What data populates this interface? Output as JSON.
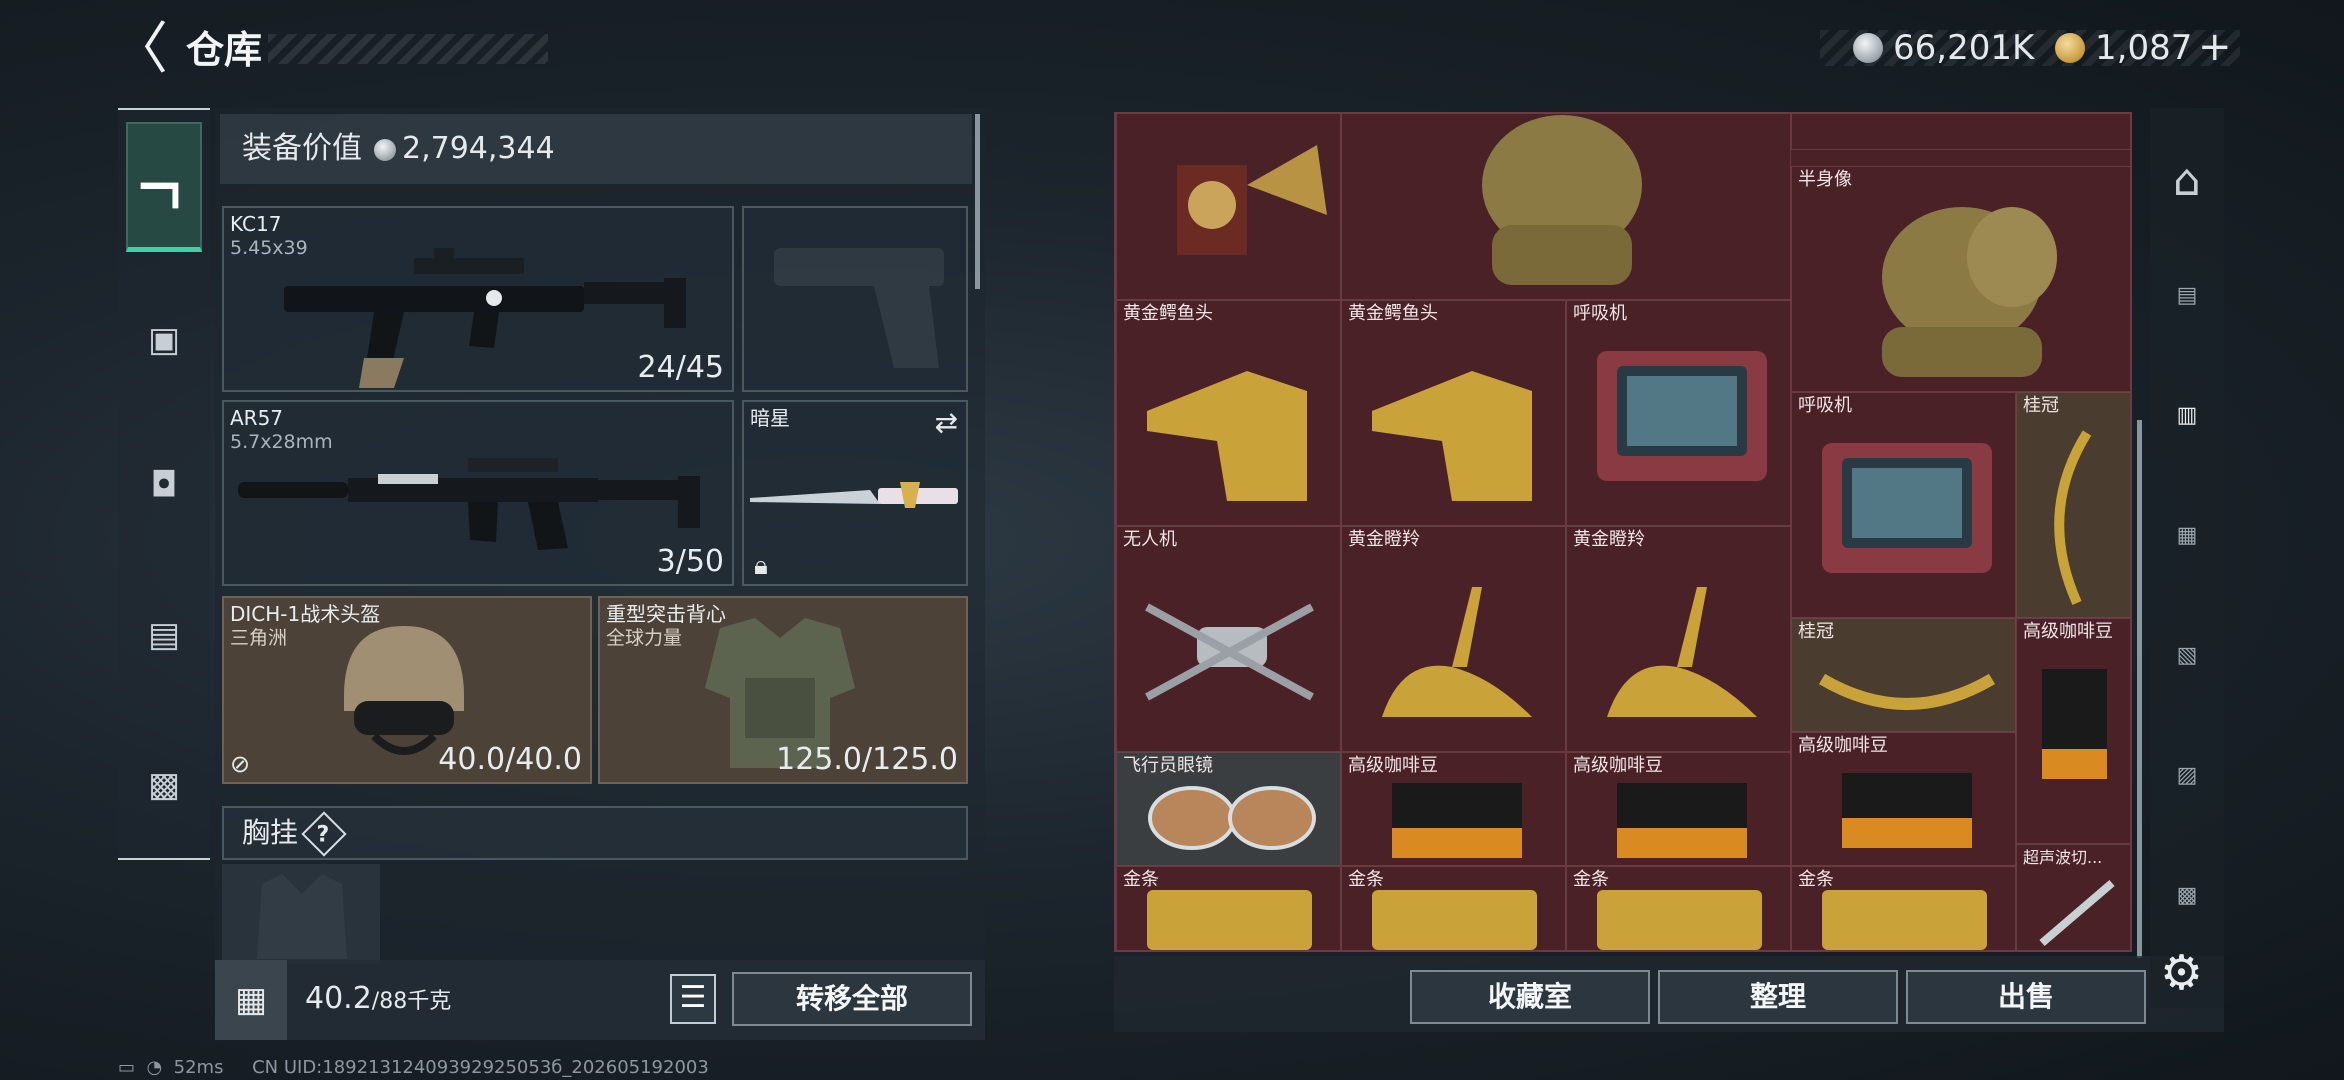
{
  "header": {
    "title": "仓库",
    "currency_silver": "66,201K",
    "currency_gold": "1,087",
    "currency_add": "+"
  },
  "left_nav": {
    "items": [
      "gun-icon",
      "backpack-icon",
      "pack-icon",
      "vest-icon",
      "case-icon"
    ]
  },
  "equipment": {
    "label": "装备价值",
    "value": "2,794,344",
    "primary": {
      "name": "KC17",
      "ammo": "5.45x39",
      "count": "24/45"
    },
    "secondary": {
      "name": "AR57",
      "ammo": "5.7x28mm",
      "count": "3/50"
    },
    "melee": {
      "name": "暗星"
    },
    "helmet": {
      "name": "DICH-1战术头盔",
      "source": "三角洲",
      "durability": "40.0/40.0"
    },
    "armor": {
      "name": "重型突击背心",
      "source": "全球力量",
      "durability": "125.0/125.0"
    },
    "chest_rig_label": "胸挂",
    "chest_rig_help": "?"
  },
  "capacity": {
    "current": "40.2",
    "max": "/88千克"
  },
  "buttons": {
    "transfer_all": "转移全部",
    "collection": "收藏室",
    "sort": "整理",
    "sell": "出售"
  },
  "grid_items": [
    {
      "name": "黄金鳄鱼头"
    },
    {
      "name": "黄金鳄鱼头"
    },
    {
      "name": "呼吸机"
    },
    {
      "name": "半身像"
    },
    {
      "name": "呼吸机"
    },
    {
      "name": "桂冠"
    },
    {
      "name": "无人机"
    },
    {
      "name": "黄金瞪羚"
    },
    {
      "name": "黄金瞪羚"
    },
    {
      "name": "桂冠"
    },
    {
      "name": "高级咖啡豆"
    },
    {
      "name": "飞行员眼镜"
    },
    {
      "name": "高级咖啡豆"
    },
    {
      "name": "高级咖啡豆"
    },
    {
      "name": "高级咖啡豆"
    },
    {
      "name": "金条"
    },
    {
      "name": "金条"
    },
    {
      "name": "金条"
    },
    {
      "name": "金条"
    },
    {
      "name": "超声波切..."
    }
  ],
  "status": {
    "ping": "52ms",
    "uid": "CN UID:18921312409392925053б_202605192003"
  }
}
